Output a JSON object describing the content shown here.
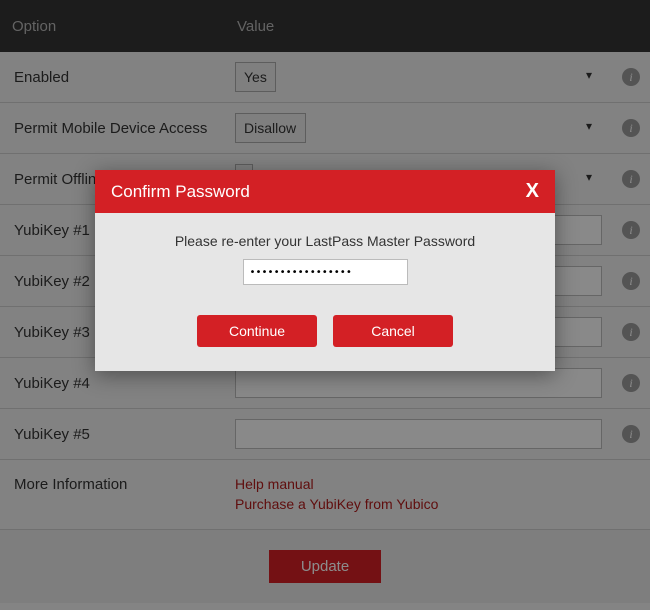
{
  "header": {
    "option": "Option",
    "value": "Value"
  },
  "rows": {
    "enabled": {
      "label": "Enabled",
      "value": "Yes"
    },
    "permit_mobile": {
      "label": "Permit Mobile Device Access",
      "value": "Disallow"
    },
    "permit_offline": {
      "label": "Permit Offline Access"
    },
    "yubi1": {
      "label": "YubiKey #1"
    },
    "yubi2": {
      "label": "YubiKey #2"
    },
    "yubi3": {
      "label": "YubiKey #3"
    },
    "yubi4": {
      "label": "YubiKey #4"
    },
    "yubi5": {
      "label": "YubiKey #5"
    },
    "more_info": {
      "label": "More Information"
    }
  },
  "links": {
    "help": "Help manual",
    "purchase": "Purchase a YubiKey from Yubico"
  },
  "footer": {
    "update": "Update"
  },
  "modal": {
    "title": "Confirm Password",
    "close": "X",
    "prompt": "Please re-enter your LastPass Master Password",
    "password_value": "•••••••••••••••••",
    "continue": "Continue",
    "cancel": "Cancel"
  },
  "info_glyph": "i"
}
